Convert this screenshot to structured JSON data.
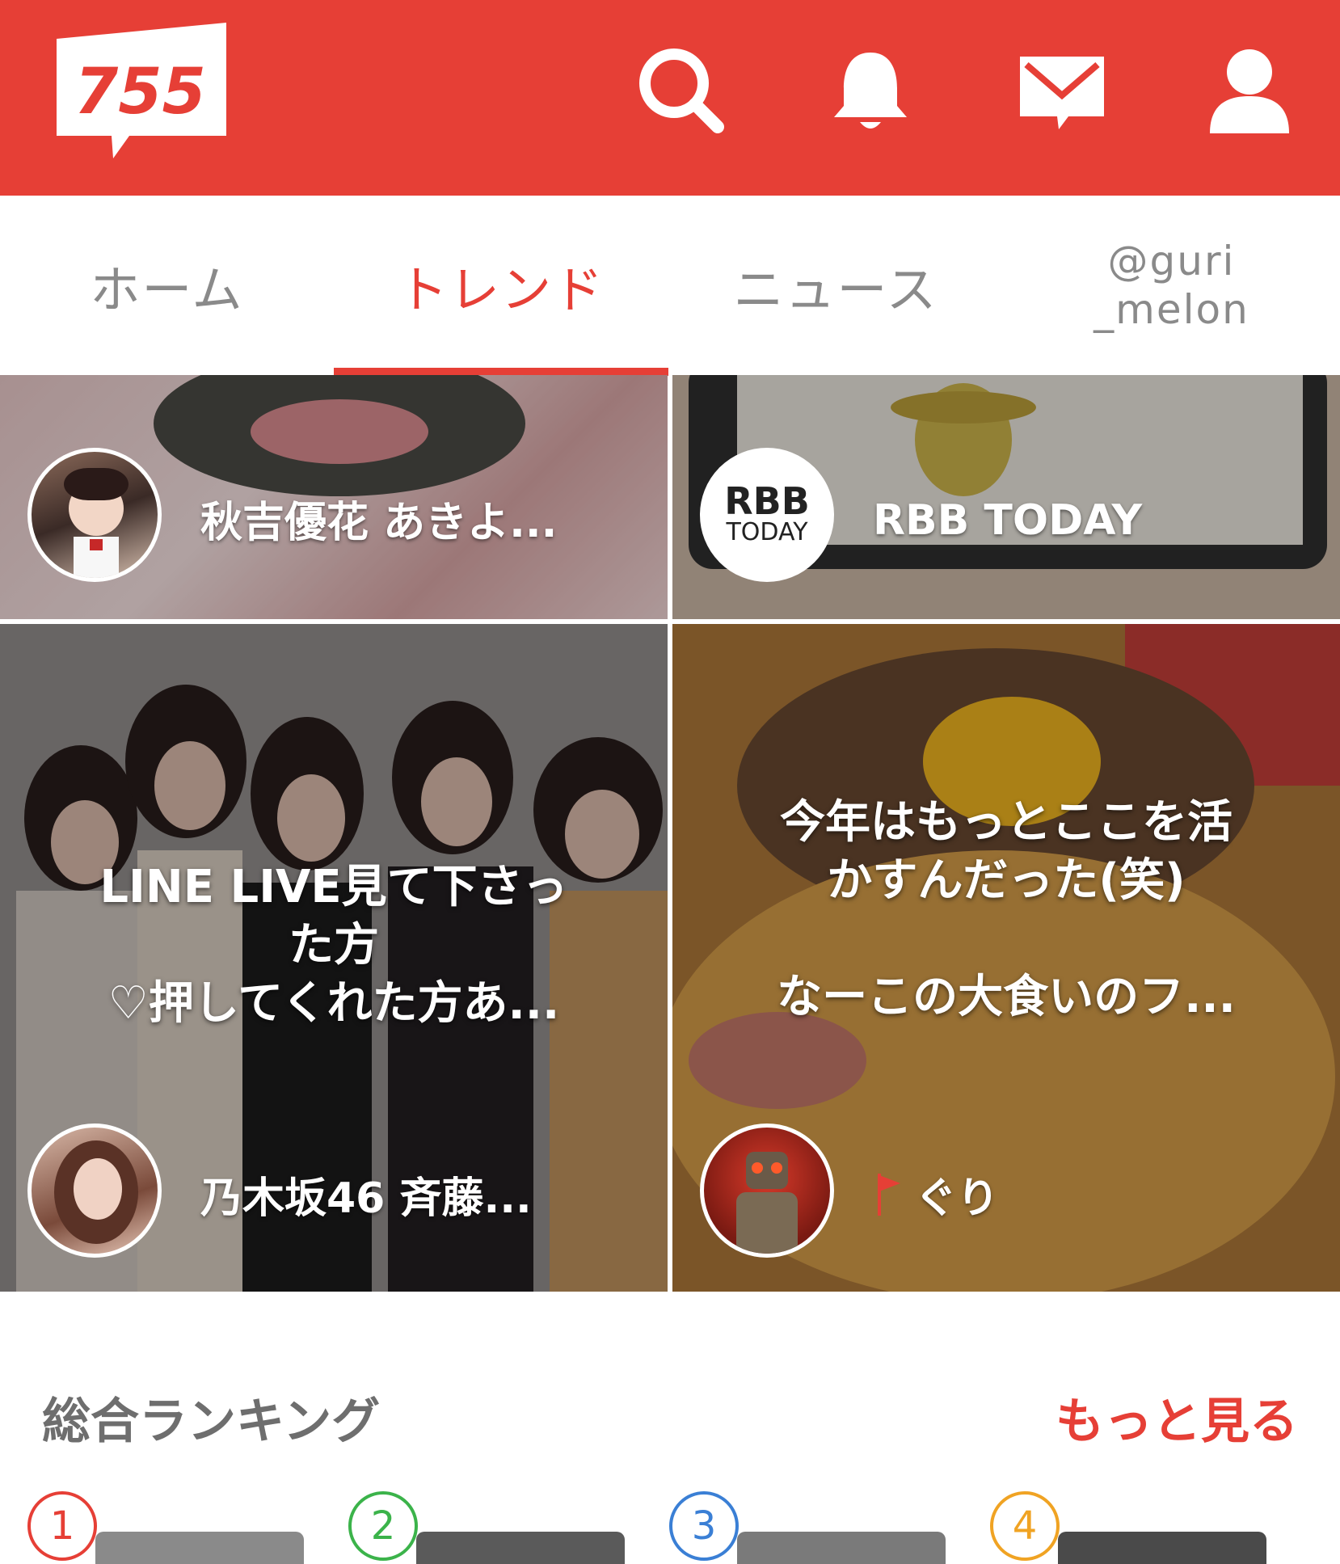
{
  "app": {
    "logo_text": "755",
    "accent_color": "#e63f36"
  },
  "header": {
    "icons": [
      "search-icon",
      "bell-icon",
      "mail-icon",
      "profile-icon"
    ]
  },
  "tabs": {
    "home": "ホーム",
    "trend": "トレンド",
    "news": "ニュース",
    "user_line1": "@guri",
    "user_line2": "_melon",
    "active": "trend"
  },
  "tiles": [
    {
      "name": "秋吉優花 あきよ..."
    },
    {
      "name": "RBB TODAY",
      "avatar_line1": "RBB",
      "avatar_line2": "TODAY"
    },
    {
      "name": "乃木坂46 斉藤...",
      "text": [
        "LINE LIVE見て下さっ",
        "た方",
        "♡押してくれた方あ..."
      ]
    },
    {
      "name": "ぐり",
      "text": [
        "今年はもっとここを活",
        "かすんだった(笑)",
        "",
        "なーこの大食いのフ..."
      ]
    }
  ],
  "ranking": {
    "title": "総合ランキング",
    "more": "もっと見る",
    "badges": [
      {
        "num": "1",
        "color": "#e63f36"
      },
      {
        "num": "2",
        "color": "#3bb34a"
      },
      {
        "num": "3",
        "color": "#3a7fd5"
      },
      {
        "num": "4",
        "color": "#f0a323"
      }
    ]
  }
}
